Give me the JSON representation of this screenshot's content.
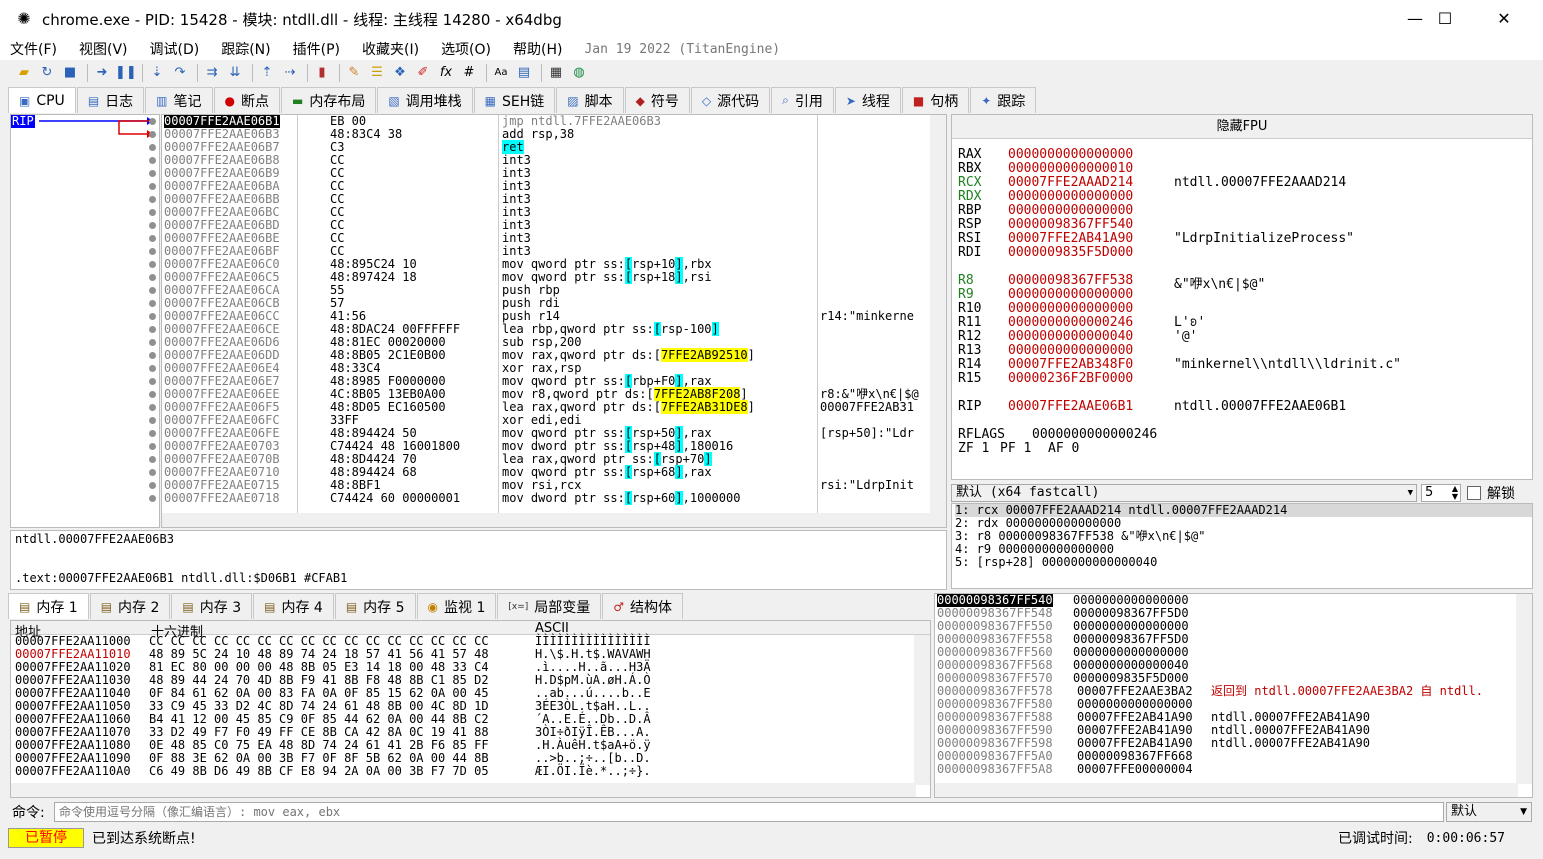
{
  "window": {
    "title": "chrome.exe - PID: 15428 - 模块: ntdll.dll - 线程: 主线程 14280 - x64dbg",
    "minimize": "—",
    "maximize": "☐",
    "close": "✕"
  },
  "menu": [
    "文件(F)",
    "视图(V)",
    "调试(D)",
    "跟踪(N)",
    "插件(P)",
    "收藏夹(I)",
    "选项(O)",
    "帮助(H)"
  ],
  "menu_date": "Jan 19 2022 (TitanEngine)",
  "tabs": [
    {
      "label": "CPU",
      "icon": "cpu-icon",
      "glyph": "▣"
    },
    {
      "label": "日志",
      "icon": "log-icon",
      "glyph": "▤"
    },
    {
      "label": "笔记",
      "icon": "notes-icon",
      "glyph": "▥"
    },
    {
      "label": "断点",
      "icon": "breakpoint-icon",
      "glyph": "●"
    },
    {
      "label": "内存布局",
      "icon": "memory-map-icon",
      "glyph": "▬"
    },
    {
      "label": "调用堆栈",
      "icon": "callstack-icon",
      "glyph": "▧"
    },
    {
      "label": "SEH链",
      "icon": "seh-icon",
      "glyph": "▦"
    },
    {
      "label": "脚本",
      "icon": "script-icon",
      "glyph": "▨"
    },
    {
      "label": "符号",
      "icon": "symbols-icon",
      "glyph": "◆"
    },
    {
      "label": "源代码",
      "icon": "source-icon",
      "glyph": "◇"
    },
    {
      "label": "引用",
      "icon": "references-icon",
      "glyph": "⌕"
    },
    {
      "label": "线程",
      "icon": "threads-icon",
      "glyph": "➤"
    },
    {
      "label": "句柄",
      "icon": "handles-icon",
      "glyph": "■"
    },
    {
      "label": "跟踪",
      "icon": "trace-icon",
      "glyph": "✦"
    }
  ],
  "rip_label": "RIP",
  "disasm": [
    {
      "addr": "00007FFE2AAE06B1",
      "bytes": "EB 00",
      "asm": "jmp ntdll.7FFE2AAE06B3",
      "cmt": ""
    },
    {
      "addr": "00007FFE2AAE06B3",
      "bytes": "48:83C4 38",
      "asm": "add rsp,38",
      "cmt": ""
    },
    {
      "addr": "00007FFE2AAE06B7",
      "bytes": "C3",
      "asm": "ret",
      "cmt": ""
    },
    {
      "addr": "00007FFE2AAE06B8",
      "bytes": "CC",
      "asm": "int3",
      "cmt": ""
    },
    {
      "addr": "00007FFE2AAE06B9",
      "bytes": "CC",
      "asm": "int3",
      "cmt": ""
    },
    {
      "addr": "00007FFE2AAE06BA",
      "bytes": "CC",
      "asm": "int3",
      "cmt": ""
    },
    {
      "addr": "00007FFE2AAE06BB",
      "bytes": "CC",
      "asm": "int3",
      "cmt": ""
    },
    {
      "addr": "00007FFE2AAE06BC",
      "bytes": "CC",
      "asm": "int3",
      "cmt": ""
    },
    {
      "addr": "00007FFE2AAE06BD",
      "bytes": "CC",
      "asm": "int3",
      "cmt": ""
    },
    {
      "addr": "00007FFE2AAE06BE",
      "bytes": "CC",
      "asm": "int3",
      "cmt": ""
    },
    {
      "addr": "00007FFE2AAE06BF",
      "bytes": "CC",
      "asm": "int3",
      "cmt": ""
    },
    {
      "addr": "00007FFE2AAE06C0",
      "bytes": "48:895C24 10",
      "asm": "mov qword ptr ss:[rsp+10],rbx",
      "cmt": ""
    },
    {
      "addr": "00007FFE2AAE06C5",
      "bytes": "48:897424 18",
      "asm": "mov qword ptr ss:[rsp+18],rsi",
      "cmt": ""
    },
    {
      "addr": "00007FFE2AAE06CA",
      "bytes": "55",
      "asm": "push rbp",
      "cmt": ""
    },
    {
      "addr": "00007FFE2AAE06CB",
      "bytes": "57",
      "asm": "push rdi",
      "cmt": ""
    },
    {
      "addr": "00007FFE2AAE06CC",
      "bytes": "41:56",
      "asm": "push r14",
      "cmt": "r14:\"minkerne"
    },
    {
      "addr": "00007FFE2AAE06CE",
      "bytes": "48:8DAC24 00FFFFFF",
      "asm": "lea rbp,qword ptr ss:[rsp-100]",
      "cmt": ""
    },
    {
      "addr": "00007FFE2AAE06D6",
      "bytes": "48:81EC 00020000",
      "asm": "sub rsp,200",
      "cmt": ""
    },
    {
      "addr": "00007FFE2AAE06DD",
      "bytes": "48:8B05 2C1E0B00",
      "asm": "mov rax,qword ptr ds:[7FFE2AB92510]",
      "cmt": ""
    },
    {
      "addr": "00007FFE2AAE06E4",
      "bytes": "48:33C4",
      "asm": "xor rax,rsp",
      "cmt": ""
    },
    {
      "addr": "00007FFE2AAE06E7",
      "bytes": "48:8985 F0000000",
      "asm": "mov qword ptr ss:[rbp+F0],rax",
      "cmt": ""
    },
    {
      "addr": "00007FFE2AAE06EE",
      "bytes": "4C:8B05 13EB0A00",
      "asm": "mov r8,qword ptr ds:[7FFE2AB8F208]",
      "cmt": "r8:&\"咿x\\n€|$@"
    },
    {
      "addr": "00007FFE2AAE06F5",
      "bytes": "48:8D05 EC160500",
      "asm": "lea rax,qword ptr ds:[7FFE2AB31DE8]",
      "cmt": "00007FFE2AB31"
    },
    {
      "addr": "00007FFE2AAE06FC",
      "bytes": "33FF",
      "asm": "xor edi,edi",
      "cmt": ""
    },
    {
      "addr": "00007FFE2AAE06FE",
      "bytes": "48:894424 50",
      "asm": "mov qword ptr ss:[rsp+50],rax",
      "cmt": "[rsp+50]:\"Ldr"
    },
    {
      "addr": "00007FFE2AAE0703",
      "bytes": "C74424 48 16001800",
      "asm": "mov dword ptr ss:[rsp+48],180016",
      "cmt": ""
    },
    {
      "addr": "00007FFE2AAE070B",
      "bytes": "48:8D4424 70",
      "asm": "lea rax,qword ptr ss:[rsp+70]",
      "cmt": ""
    },
    {
      "addr": "00007FFE2AAE0710",
      "bytes": "48:894424 68",
      "asm": "mov qword ptr ss:[rsp+68],rax",
      "cmt": ""
    },
    {
      "addr": "00007FFE2AAE0715",
      "bytes": "48:8BF1",
      "asm": "mov rsi,rcx",
      "cmt": "rsi:\"LdrpInit"
    },
    {
      "addr": "00007FFE2AAE0718",
      "bytes": "C74424 60 00000001",
      "asm": "mov dword ptr ss:[rsp+60],1000000",
      "cmt": ""
    }
  ],
  "fpu_header": "隐藏FPU",
  "registers": [
    {
      "name": "RAX",
      "value": "0000000000000000",
      "comment": ""
    },
    {
      "name": "RBX",
      "value": "0000000000000010",
      "comment": ""
    },
    {
      "name": "RCX",
      "value": "00007FFE2AAAD214",
      "comment": "ntdll.00007FFE2AAAD214"
    },
    {
      "name": "RDX",
      "value": "0000000000000000",
      "comment": ""
    },
    {
      "name": "RBP",
      "value": "0000000000000000",
      "comment": ""
    },
    {
      "name": "RSP",
      "value": "00000098367FF540",
      "comment": ""
    },
    {
      "name": "RSI",
      "value": "00007FFE2AB41A90",
      "comment": "\"LdrpInitializeProcess\""
    },
    {
      "name": "RDI",
      "value": "0000009835F5D000",
      "comment": ""
    },
    {
      "name": "",
      "value": "",
      "comment": ""
    },
    {
      "name": "R8",
      "value": "00000098367FF538",
      "comment": "&\"咿x\\n€|$@\""
    },
    {
      "name": "R9",
      "value": "0000000000000000",
      "comment": ""
    },
    {
      "name": "R10",
      "value": "0000000000000000",
      "comment": ""
    },
    {
      "name": "R11",
      "value": "0000000000000246",
      "comment": "L'ʚ'"
    },
    {
      "name": "R12",
      "value": "0000000000000040",
      "comment": "'@'"
    },
    {
      "name": "R13",
      "value": "0000000000000000",
      "comment": ""
    },
    {
      "name": "R14",
      "value": "00007FFE2AB348F0",
      "comment": "\"minkernel\\\\ntdll\\\\ldrinit.c\""
    },
    {
      "name": "R15",
      "value": "00000236F2BF0000",
      "comment": ""
    },
    {
      "name": "",
      "value": "",
      "comment": ""
    },
    {
      "name": "RIP",
      "value": "00007FFE2AAE06B1",
      "comment": "ntdll.00007FFE2AAE06B1"
    },
    {
      "name": "",
      "value": "",
      "comment": ""
    },
    {
      "name": "RFLAGS",
      "value": "0000000000000246",
      "comment": ""
    },
    {
      "name": "ZF 1",
      "value": "PF 1",
      "comment": "AF 0"
    }
  ],
  "callconv": {
    "label": "默认 (x64 fastcall)",
    "count": "5",
    "unlock": "解锁"
  },
  "args": [
    "1: rcx 00007FFE2AAAD214 ntdll.00007FFE2AAAD214",
    "2: rdx 0000000000000000",
    "3: r8 00000098367FF538 &\"咿x\\n€|$@\"",
    "4: r9 0000000000000000",
    "5: [rsp+28] 0000000000000040"
  ],
  "info": {
    "line1": "ntdll.00007FFE2AAE06B3",
    "line2": ".text:00007FFE2AAE06B1 ntdll.dll:$D06B1 #CFAB1"
  },
  "bottom_tabs": [
    {
      "label": "内存 1",
      "icon": "memory-icon"
    },
    {
      "label": "内存 2",
      "icon": "memory-icon"
    },
    {
      "label": "内存 3",
      "icon": "memory-icon"
    },
    {
      "label": "内存 4",
      "icon": "memory-icon"
    },
    {
      "label": "内存 5",
      "icon": "memory-icon"
    },
    {
      "label": "监视 1",
      "icon": "watch-icon"
    },
    {
      "label": "局部变量",
      "icon": "locals-icon"
    },
    {
      "label": "结构体",
      "icon": "struct-icon"
    }
  ],
  "dump_headers": {
    "addr": "地址",
    "hex": "十六进制",
    "ascii": "ASCII"
  },
  "dump": [
    {
      "addr": "00007FFE2AA11000",
      "hex": "CC CC CC CC CC CC CC CC CC CC CC CC CC CC CC CC",
      "ascii": "ÌÌÌÌÌÌÌÌÌÌÌÌÌÌÌÌ"
    },
    {
      "addr": "00007FFE2AA11010",
      "hex": "48 89 5C 24 10 48 89 74 24 18 57 41 56 41 57 48",
      "ascii": "H.\\$.H.t$.WAVAWH"
    },
    {
      "addr": "00007FFE2AA11020",
      "hex": "81 EC 80 00 00 00 48 8B 05 E3 14 18 00 48 33 C4",
      "ascii": ".ì....H..ã...H3Ä"
    },
    {
      "addr": "00007FFE2AA11030",
      "hex": "48 89 44 24 70 4D 8B F9 41 8B F8 48 8B C1 85 D2",
      "ascii": "H.D$pM.ùA.øH.Á.Ò"
    },
    {
      "addr": "00007FFE2AA11040",
      "hex": "0F 84 61 62 0A 00 83 FA 0A 0F 85 15 62 0A 00 45",
      "ascii": "..ab...ú....b..E"
    },
    {
      "addr": "00007FFE2AA11050",
      "hex": "33 C9 45 33 D2 4C 8D 74 24 61 48 8B 00 4C 8D 1D",
      "ascii": "3ÉE3ÒL.t$aH..L.."
    },
    {
      "addr": "00007FFE2AA11060",
      "hex": "B4 41 12 00 45 85 C9 0F 85 44 62 0A 00 44 8B C2",
      "ascii": "´A..E.É..Db..D.Â"
    },
    {
      "addr": "00007FFE2AA11070",
      "hex": "33 D2 49 F7 F0 49 FF CE 8B CA 42 8A 0C 19 41 88",
      "ascii": "3ÒI÷ðIÿÎ.ÊB...A."
    },
    {
      "addr": "00007FFE2AA11080",
      "hex": "0E 48 85 C0 75 EA 48 8D 74 24 61 41 2B F6 85 FF",
      "ascii": ".H.ÀuêH.t$aA+ö.ÿ"
    },
    {
      "addr": "00007FFE2AA11090",
      "hex": "0F 88 3E 62 0A 00 3B F7 0F 8F 5B 62 0A 00 44 8B",
      "ascii": "..>b..;÷..[b..D."
    },
    {
      "addr": "00007FFE2AA110A0",
      "hex": "C6 49 8B D6 49 8B CF E8 94 2A 0A 00 3B F7 7D 05",
      "ascii": "ÆI.ÖI.Ïè.*..;÷}."
    }
  ],
  "stack": [
    {
      "addr": "00000098367FF540",
      "val": "0000000000000000",
      "cmt": ""
    },
    {
      "addr": "00000098367FF548",
      "val": "00000098367FF5D0",
      "cmt": ""
    },
    {
      "addr": "00000098367FF550",
      "val": "0000000000000000",
      "cmt": ""
    },
    {
      "addr": "00000098367FF558",
      "val": "00000098367FF5D0",
      "cmt": ""
    },
    {
      "addr": "00000098367FF560",
      "val": "0000000000000000",
      "cmt": ""
    },
    {
      "addr": "00000098367FF568",
      "val": "0000000000000040",
      "cmt": ""
    },
    {
      "addr": "00000098367FF570",
      "val": "0000009835F5D000",
      "cmt": ""
    },
    {
      "addr": "00000098367FF578",
      "val": "00007FFE2AAE3BA2",
      "cmt": "返回到 ntdll.00007FFE2AAE3BA2 自 ntdll."
    },
    {
      "addr": "00000098367FF580",
      "val": "0000000000000000",
      "cmt": ""
    },
    {
      "addr": "00000098367FF588",
      "val": "00007FFE2AB41A90",
      "cmt": "ntdll.00007FFE2AB41A90"
    },
    {
      "addr": "00000098367FF590",
      "val": "00007FFE2AB41A90",
      "cmt": "ntdll.00007FFE2AB41A90"
    },
    {
      "addr": "00000098367FF598",
      "val": "00007FFE2AB41A90",
      "cmt": "ntdll.00007FFE2AB41A90"
    },
    {
      "addr": "00000098367FF5A0",
      "val": "00000098367FF668",
      "cmt": ""
    },
    {
      "addr": "00000098367FF5A8",
      "val": "00007FFE00000004",
      "cmt": ""
    }
  ],
  "cmd": {
    "label": "命令:",
    "placeholder": "命令使用逗号分隔（像汇编语言）: mov eax, ebx",
    "mode": "默认"
  },
  "status": {
    "state": "已暂停",
    "message": "已到达系统断点!",
    "time_label": "已调试时间:",
    "time": "0:00:06:57"
  },
  "colors": {
    "accent": "#ffff00",
    "reg": "#00ffff",
    "value_red": "#c00000",
    "paused_bg": "#ffff00",
    "paused_fg": "#ff0000"
  }
}
